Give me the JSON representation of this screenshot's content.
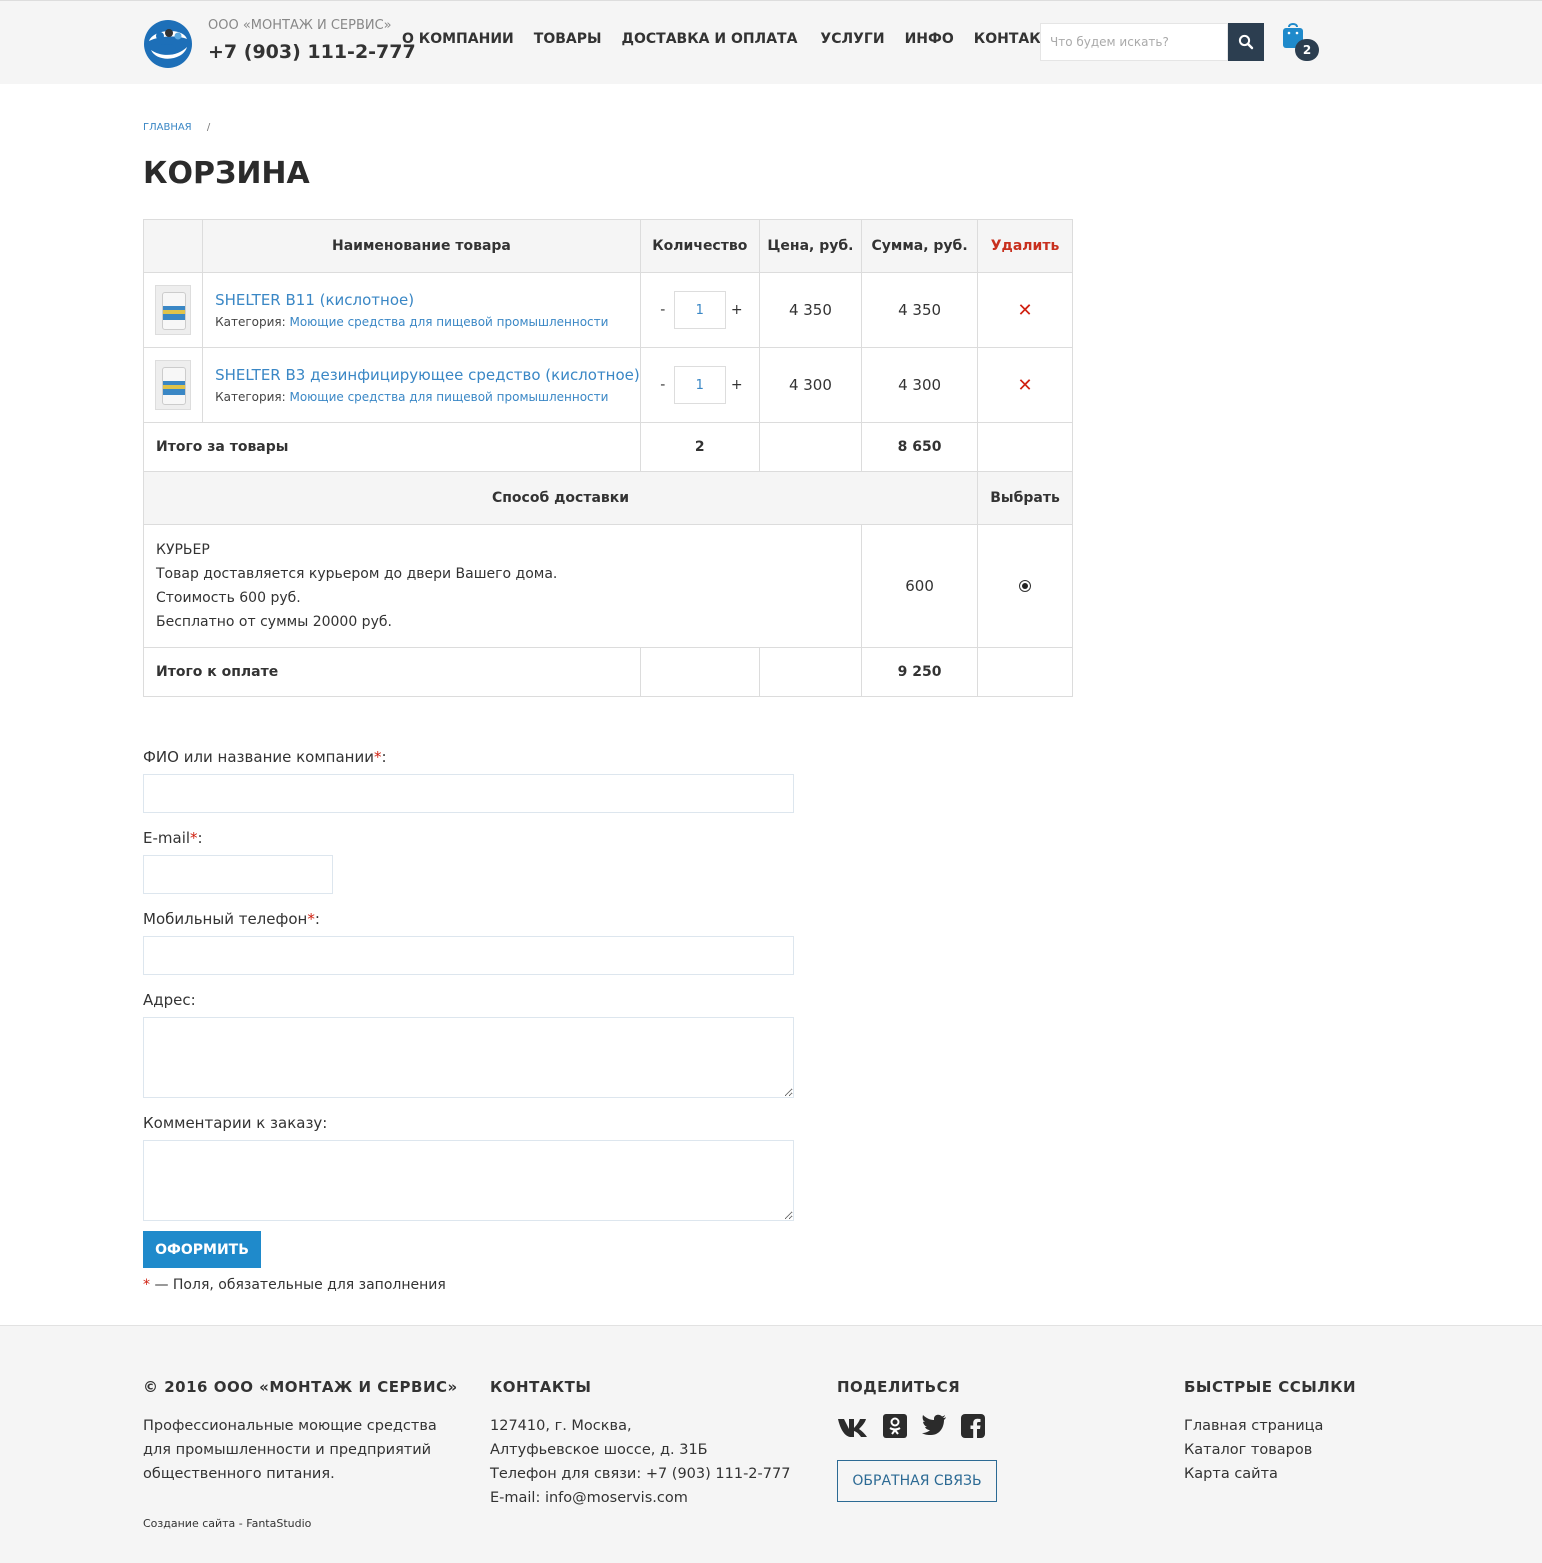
{
  "header": {
    "company_name": "ООО «МОНТАЖ И СЕРВИС»",
    "phone": "+7 (903) 111-2-777",
    "nav": [
      "О КОМПАНИИ",
      "ТОВАРЫ",
      "ДОСТАВКА И ОПЛАТА",
      "УСЛУГИ",
      "ИНФО",
      "КОНТАКТЫ"
    ],
    "search_placeholder": "Что будем искать?",
    "cart_count": "2"
  },
  "breadcrumb": {
    "home": "ГЛАВНАЯ",
    "separator": "/"
  },
  "page_title": "КОРЗИНА",
  "cart": {
    "headers": {
      "name": "Наименование товара",
      "qty": "Количество",
      "price": "Цена, руб.",
      "sum": "Сумма, руб.",
      "remove": "Удалить"
    },
    "items": [
      {
        "name": "SHELTER B11 (кислотное)",
        "category_label": "Категория: ",
        "category": "Моющие средства для пищевой промышленности",
        "qty_minus": "-",
        "qty": "1",
        "qty_plus": "+",
        "price": "4 350",
        "sum": "4 350",
        "remove": "✕"
      },
      {
        "name": "SHELTER B3 дезинфицирующее средство (кислотное)",
        "category_label": "Категория: ",
        "category": "Моющие средства для пищевой промышленности",
        "qty_minus": "-",
        "qty": "1",
        "qty_plus": "+",
        "price": "4 300",
        "sum": "4 300",
        "remove": "✕"
      }
    ],
    "goods_total_label": "Итого за товары",
    "goods_total_qty": "2",
    "goods_total_sum": "8 650",
    "delivery_header": "Способ доставки",
    "delivery_choose": "Выбрать",
    "delivery": {
      "title": "КУРЬЕР",
      "line1": "Товар доставляется курьером до двери Вашего дома.",
      "line2": "Стоимость 600 руб.",
      "line3": "Бесплатно от суммы 20000 руб.",
      "price": "600",
      "selected": true
    },
    "pay_total_label": "Итого к оплате",
    "pay_total_sum": "9 250"
  },
  "form": {
    "name_label": "ФИО или название компании",
    "email_label": "E-mail",
    "phone_label": "Мобильный телефон",
    "address_label": "Адрес:",
    "comment_label": "Комментарии к заказу:",
    "required_mark": "*",
    "colon": ":",
    "submit": "ОФОРМИТЬ",
    "required_note": " — Поля, обязательные для заполнения"
  },
  "footer": {
    "copyright": "© 2016 ООО «МОНТАЖ И СЕРВИС»",
    "about": [
      "Профессиональные моющие средства",
      "для промышленности и  предприятий",
      "общественного питания."
    ],
    "credit": "Создание сайта - FantaStudio",
    "contacts_title": "КОНТАКТЫ",
    "contacts": [
      "127410, г. Москва,",
      "Алтуфьевское шоссе, д. 31Б",
      "Телефон для связи: +7 (903) 111-2-777",
      "E-mail: info@moservis.com"
    ],
    "share_title": "ПОДЕЛИТЬСЯ",
    "social_icons": [
      "vk-icon",
      "odnoklassniki-icon",
      "twitter-icon",
      "facebook-icon"
    ],
    "feedback": "ОБРАТНАЯ СВЯЗЬ",
    "links_title": "БЫСТРЫЕ ССЫЛКИ",
    "links": [
      "Главная страница",
      "Каталог товаров",
      "Карта сайта"
    ]
  },
  "colors": {
    "accent": "#1f8acb",
    "link": "#3a87c5",
    "dark": "#2c3e50",
    "danger": "#d02010"
  }
}
